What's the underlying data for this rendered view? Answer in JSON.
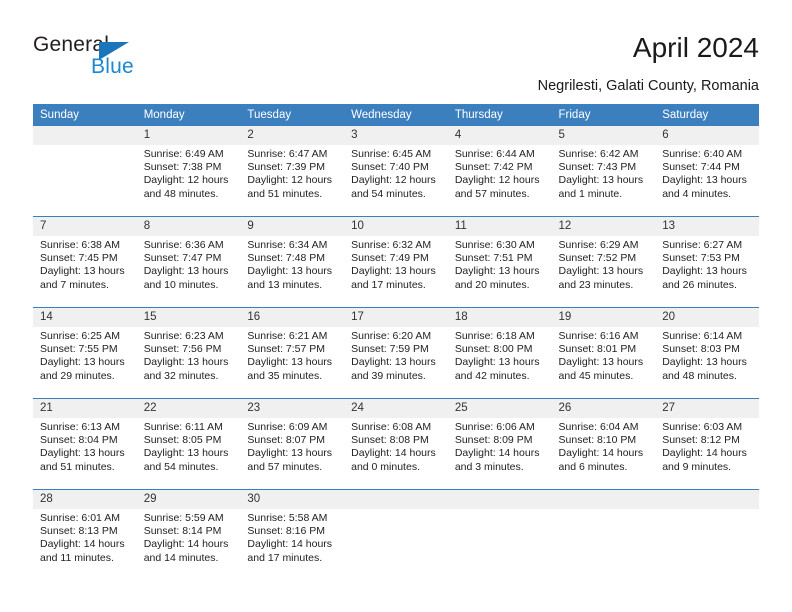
{
  "brand": {
    "name_top": "General",
    "name_bottom": "Blue",
    "accent_color": "#1b87d2",
    "triangle_color": "#1b75bb"
  },
  "header": {
    "title": "April 2024",
    "subtitle": "Negrilesti, Galati County, Romania",
    "header_bg": "#3c7fbf",
    "daynum_bg": "#f0f0f0"
  },
  "weekdays": [
    "Sunday",
    "Monday",
    "Tuesday",
    "Wednesday",
    "Thursday",
    "Friday",
    "Saturday"
  ],
  "weeks": [
    [
      {
        "day": "",
        "blank": true
      },
      {
        "day": "1",
        "sunrise": "Sunrise: 6:49 AM",
        "sunset": "Sunset: 7:38 PM",
        "daylight": "Daylight: 12 hours and 48 minutes."
      },
      {
        "day": "2",
        "sunrise": "Sunrise: 6:47 AM",
        "sunset": "Sunset: 7:39 PM",
        "daylight": "Daylight: 12 hours and 51 minutes."
      },
      {
        "day": "3",
        "sunrise": "Sunrise: 6:45 AM",
        "sunset": "Sunset: 7:40 PM",
        "daylight": "Daylight: 12 hours and 54 minutes."
      },
      {
        "day": "4",
        "sunrise": "Sunrise: 6:44 AM",
        "sunset": "Sunset: 7:42 PM",
        "daylight": "Daylight: 12 hours and 57 minutes."
      },
      {
        "day": "5",
        "sunrise": "Sunrise: 6:42 AM",
        "sunset": "Sunset: 7:43 PM",
        "daylight": "Daylight: 13 hours and 1 minute."
      },
      {
        "day": "6",
        "sunrise": "Sunrise: 6:40 AM",
        "sunset": "Sunset: 7:44 PM",
        "daylight": "Daylight: 13 hours and 4 minutes."
      }
    ],
    [
      {
        "day": "7",
        "sunrise": "Sunrise: 6:38 AM",
        "sunset": "Sunset: 7:45 PM",
        "daylight": "Daylight: 13 hours and 7 minutes."
      },
      {
        "day": "8",
        "sunrise": "Sunrise: 6:36 AM",
        "sunset": "Sunset: 7:47 PM",
        "daylight": "Daylight: 13 hours and 10 minutes."
      },
      {
        "day": "9",
        "sunrise": "Sunrise: 6:34 AM",
        "sunset": "Sunset: 7:48 PM",
        "daylight": "Daylight: 13 hours and 13 minutes."
      },
      {
        "day": "10",
        "sunrise": "Sunrise: 6:32 AM",
        "sunset": "Sunset: 7:49 PM",
        "daylight": "Daylight: 13 hours and 17 minutes."
      },
      {
        "day": "11",
        "sunrise": "Sunrise: 6:30 AM",
        "sunset": "Sunset: 7:51 PM",
        "daylight": "Daylight: 13 hours and 20 minutes."
      },
      {
        "day": "12",
        "sunrise": "Sunrise: 6:29 AM",
        "sunset": "Sunset: 7:52 PM",
        "daylight": "Daylight: 13 hours and 23 minutes."
      },
      {
        "day": "13",
        "sunrise": "Sunrise: 6:27 AM",
        "sunset": "Sunset: 7:53 PM",
        "daylight": "Daylight: 13 hours and 26 minutes."
      }
    ],
    [
      {
        "day": "14",
        "sunrise": "Sunrise: 6:25 AM",
        "sunset": "Sunset: 7:55 PM",
        "daylight": "Daylight: 13 hours and 29 minutes."
      },
      {
        "day": "15",
        "sunrise": "Sunrise: 6:23 AM",
        "sunset": "Sunset: 7:56 PM",
        "daylight": "Daylight: 13 hours and 32 minutes."
      },
      {
        "day": "16",
        "sunrise": "Sunrise: 6:21 AM",
        "sunset": "Sunset: 7:57 PM",
        "daylight": "Daylight: 13 hours and 35 minutes."
      },
      {
        "day": "17",
        "sunrise": "Sunrise: 6:20 AM",
        "sunset": "Sunset: 7:59 PM",
        "daylight": "Daylight: 13 hours and 39 minutes."
      },
      {
        "day": "18",
        "sunrise": "Sunrise: 6:18 AM",
        "sunset": "Sunset: 8:00 PM",
        "daylight": "Daylight: 13 hours and 42 minutes."
      },
      {
        "day": "19",
        "sunrise": "Sunrise: 6:16 AM",
        "sunset": "Sunset: 8:01 PM",
        "daylight": "Daylight: 13 hours and 45 minutes."
      },
      {
        "day": "20",
        "sunrise": "Sunrise: 6:14 AM",
        "sunset": "Sunset: 8:03 PM",
        "daylight": "Daylight: 13 hours and 48 minutes."
      }
    ],
    [
      {
        "day": "21",
        "sunrise": "Sunrise: 6:13 AM",
        "sunset": "Sunset: 8:04 PM",
        "daylight": "Daylight: 13 hours and 51 minutes."
      },
      {
        "day": "22",
        "sunrise": "Sunrise: 6:11 AM",
        "sunset": "Sunset: 8:05 PM",
        "daylight": "Daylight: 13 hours and 54 minutes."
      },
      {
        "day": "23",
        "sunrise": "Sunrise: 6:09 AM",
        "sunset": "Sunset: 8:07 PM",
        "daylight": "Daylight: 13 hours and 57 minutes."
      },
      {
        "day": "24",
        "sunrise": "Sunrise: 6:08 AM",
        "sunset": "Sunset: 8:08 PM",
        "daylight": "Daylight: 14 hours and 0 minutes."
      },
      {
        "day": "25",
        "sunrise": "Sunrise: 6:06 AM",
        "sunset": "Sunset: 8:09 PM",
        "daylight": "Daylight: 14 hours and 3 minutes."
      },
      {
        "day": "26",
        "sunrise": "Sunrise: 6:04 AM",
        "sunset": "Sunset: 8:10 PM",
        "daylight": "Daylight: 14 hours and 6 minutes."
      },
      {
        "day": "27",
        "sunrise": "Sunrise: 6:03 AM",
        "sunset": "Sunset: 8:12 PM",
        "daylight": "Daylight: 14 hours and 9 minutes."
      }
    ],
    [
      {
        "day": "28",
        "sunrise": "Sunrise: 6:01 AM",
        "sunset": "Sunset: 8:13 PM",
        "daylight": "Daylight: 14 hours and 11 minutes."
      },
      {
        "day": "29",
        "sunrise": "Sunrise: 5:59 AM",
        "sunset": "Sunset: 8:14 PM",
        "daylight": "Daylight: 14 hours and 14 minutes."
      },
      {
        "day": "30",
        "sunrise": "Sunrise: 5:58 AM",
        "sunset": "Sunset: 8:16 PM",
        "daylight": "Daylight: 14 hours and 17 minutes."
      },
      {
        "day": "",
        "blank": true
      },
      {
        "day": "",
        "blank": true
      },
      {
        "day": "",
        "blank": true
      },
      {
        "day": "",
        "blank": true
      }
    ]
  ]
}
